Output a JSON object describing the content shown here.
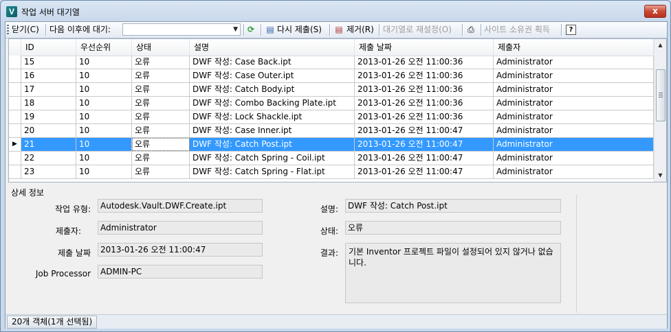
{
  "window": {
    "title": "작업 서버 대기열",
    "icon": "vault-app-icon",
    "close_label": "x"
  },
  "toolbar": {
    "close_label": "닫기(C)",
    "wait_label": "다음 이후에 대기:",
    "wait_value": "",
    "refresh_icon": "refresh-icon",
    "resubmit_label": "다시 제출(S)",
    "remove_label": "제거(R)",
    "reset_label": "대기열로 재설정(O)",
    "print_icon": "printer-icon",
    "reclaim_label": "사이트 소유권 획득",
    "help_label": "?"
  },
  "grid": {
    "columns": [
      "ID",
      "우선순위",
      "상태",
      "설명",
      "제출 날짜",
      "제출자"
    ],
    "rows": [
      {
        "id": "15",
        "priority": "10",
        "status": "오류",
        "desc": "DWF 작성: Case Back.ipt",
        "date": "2013-01-26 오전 11:00:36",
        "user": "Administrator"
      },
      {
        "id": "16",
        "priority": "10",
        "status": "오류",
        "desc": "DWF 작성: Case Outer.ipt",
        "date": "2013-01-26 오전 11:00:36",
        "user": "Administrator"
      },
      {
        "id": "17",
        "priority": "10",
        "status": "오류",
        "desc": "DWF 작성: Catch Body.ipt",
        "date": "2013-01-26 오전 11:00:36",
        "user": "Administrator"
      },
      {
        "id": "18",
        "priority": "10",
        "status": "오류",
        "desc": "DWF 작성: Combo Backing Plate.ipt",
        "date": "2013-01-26 오전 11:00:36",
        "user": "Administrator"
      },
      {
        "id": "19",
        "priority": "10",
        "status": "오류",
        "desc": "DWF 작성: Lock Shackle.ipt",
        "date": "2013-01-26 오전 11:00:36",
        "user": "Administrator"
      },
      {
        "id": "20",
        "priority": "10",
        "status": "오류",
        "desc": "DWF 작성: Case Inner.ipt",
        "date": "2013-01-26 오전 11:00:47",
        "user": "Administrator"
      },
      {
        "id": "21",
        "priority": "10",
        "status": "오류",
        "desc": "DWF 작성: Catch Post.ipt",
        "date": "2013-01-26 오전 11:00:47",
        "user": "Administrator",
        "selected": true
      },
      {
        "id": "22",
        "priority": "10",
        "status": "오류",
        "desc": "DWF 작성: Catch Spring - Coil.ipt",
        "date": "2013-01-26 오전 11:00:47",
        "user": "Administrator"
      },
      {
        "id": "23",
        "priority": "10",
        "status": "오류",
        "desc": "DWF 작성: Catch Spring - Flat.ipt",
        "date": "2013-01-26 오전 11:00:47",
        "user": "Administrator"
      }
    ],
    "selection_color": "#3399ff"
  },
  "details": {
    "title": "상세 정보",
    "job_type_label": "작업 유형:",
    "job_type": "Autodesk.Vault.DWF.Create.ipt",
    "submitter_label": "제출자:",
    "submitter": "Administrator",
    "date_label": "제출 날짜",
    "date": "2013-01-26 오전 11:00:47",
    "processor_label": "Job Processor",
    "processor": "ADMIN-PC",
    "desc_label": "설명:",
    "desc": "DWF 작성: Catch Post.ipt",
    "status_label": "상태:",
    "status": "오류",
    "result_label": "결과:",
    "result": "기본 Inventor 프로젝트 파일이 설정되어 있지 않거나 없습니다."
  },
  "statusbar": {
    "count": "20개 객체(1개 선택됨)"
  }
}
